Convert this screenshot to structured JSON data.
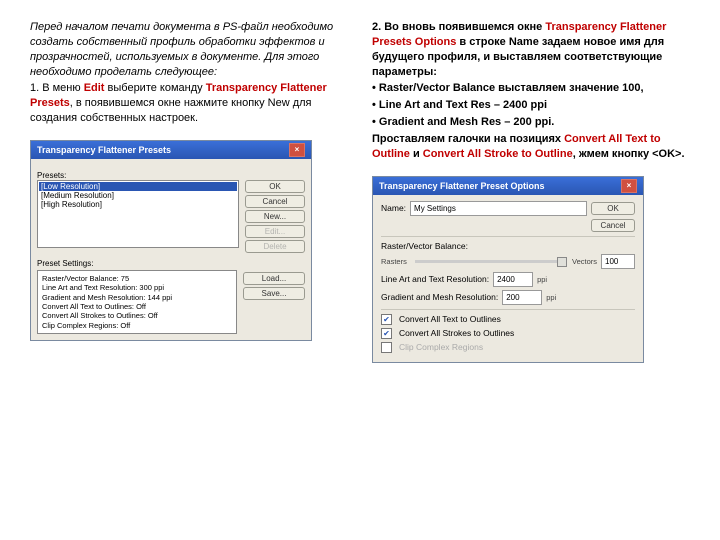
{
  "left": {
    "p1": "Перед началом печати документа в PS-файл необходимо создать собственный профиль обработки эффектов и прозрачностей, используемых в документе. Для этого необходимо проделать следующее:",
    "p2_a": "1. В меню ",
    "p2_edit": "Edit",
    "p2_b": " выберите команду ",
    "p2_tfp": "Transparency Flattener Presets",
    "p2_c": ", в появившемся окне нажмите кнопку New для создания собственных настроек."
  },
  "right": {
    "p1_a": "2. Во вновь появившемся окне ",
    "p1_tfpo": "Transparency Flattener Presets Options",
    "p1_b": " в строке Name задаем новое имя для будущего профиля, и выставляем соответствующие параметры:",
    "b1": "Raster/Vector Balance выставляем значение 100,",
    "b2": "Line Art and Text Res – 2400 ppi",
    "b3": "Gradient and Mesh Res – 200 ppi.",
    "p2_a": "Проставляем галочки на позициях ",
    "p2_c1": "Convert All Text to Outline",
    "p2_b": " и ",
    "p2_c2": "Convert All Stroke to Outline",
    "p2_c": ", жмем кнопку <OK>."
  },
  "win1": {
    "title": "Transparency Flattener Presets",
    "label_presets": "Presets:",
    "items": {
      "i0": "[Low Resolution]",
      "i1": "[Medium Resolution]",
      "i2": "[High Resolution]"
    },
    "btn_ok": "OK",
    "btn_cancel": "Cancel",
    "btn_new": "New...",
    "btn_edit": "Edit...",
    "btn_delete": "Delete",
    "label_settings": "Preset Settings:",
    "s0": "Raster/Vector Balance: 75",
    "s1": "Line Art and Text Resolution: 300 ppi",
    "s2": "Gradient and Mesh Resolution: 144 ppi",
    "s3": "Convert All Text to Outlines: Off",
    "s4": "Convert All Strokes to Outlines: Off",
    "s5": "Clip Complex Regions: Off",
    "btn_load": "Load...",
    "btn_save": "Save..."
  },
  "win2": {
    "title": "Transparency Flattener Preset Options",
    "lbl_name": "Name:",
    "val_name": "My Settings",
    "lbl_balance": "Raster/Vector Balance:",
    "lbl_rasters": "Rasters",
    "lbl_vectors": "Vectors",
    "val_balance": "100",
    "lbl_line": "Line Art and Text Resolution:",
    "val_line": "2400",
    "unit_ppi": "ppi",
    "lbl_grad": "Gradient and Mesh Resolution:",
    "val_grad": "200",
    "chk_text": "Convert All Text to Outlines",
    "chk_stroke": "Convert All Strokes to Outlines",
    "chk_clip": "Clip Complex Regions",
    "btn_ok": "OK",
    "btn_cancel": "Cancel"
  }
}
